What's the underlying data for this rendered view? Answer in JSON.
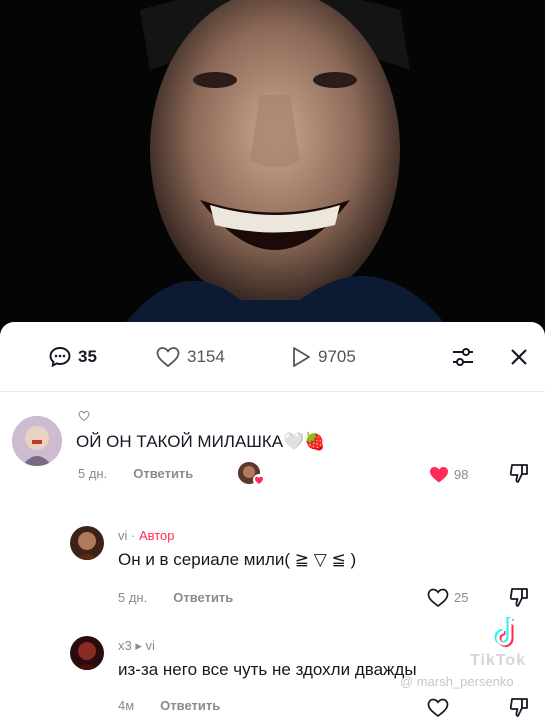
{
  "video": {
    "description_icon": "video-frame"
  },
  "stats": {
    "comments": "35",
    "likes": "3154",
    "views": "9705"
  },
  "comments": [
    {
      "text": "ОЙ ОН ТАКОЙ МИЛАШКА",
      "emoji": "🤍🍓",
      "time": "5 дн.",
      "reply": "Ответить",
      "likes": "98"
    },
    {
      "user": "vi",
      "author_tag": "Автор",
      "text": "Он и в сериале мили( ≧ ▽ ≦ )",
      "time": "5 дн.",
      "reply": "Ответить",
      "likes": "25"
    },
    {
      "user": "x3",
      "reply_to": "vi",
      "text": "из-за него все чуть не здохли дважды",
      "time": "4м",
      "reply": "Ответить"
    }
  ],
  "watermark": {
    "brand": "TikTok",
    "handle": "@ marsh_persenko"
  },
  "colors": {
    "accent": "#fe2c55",
    "text": "#161823",
    "muted": "#8a8b91"
  }
}
